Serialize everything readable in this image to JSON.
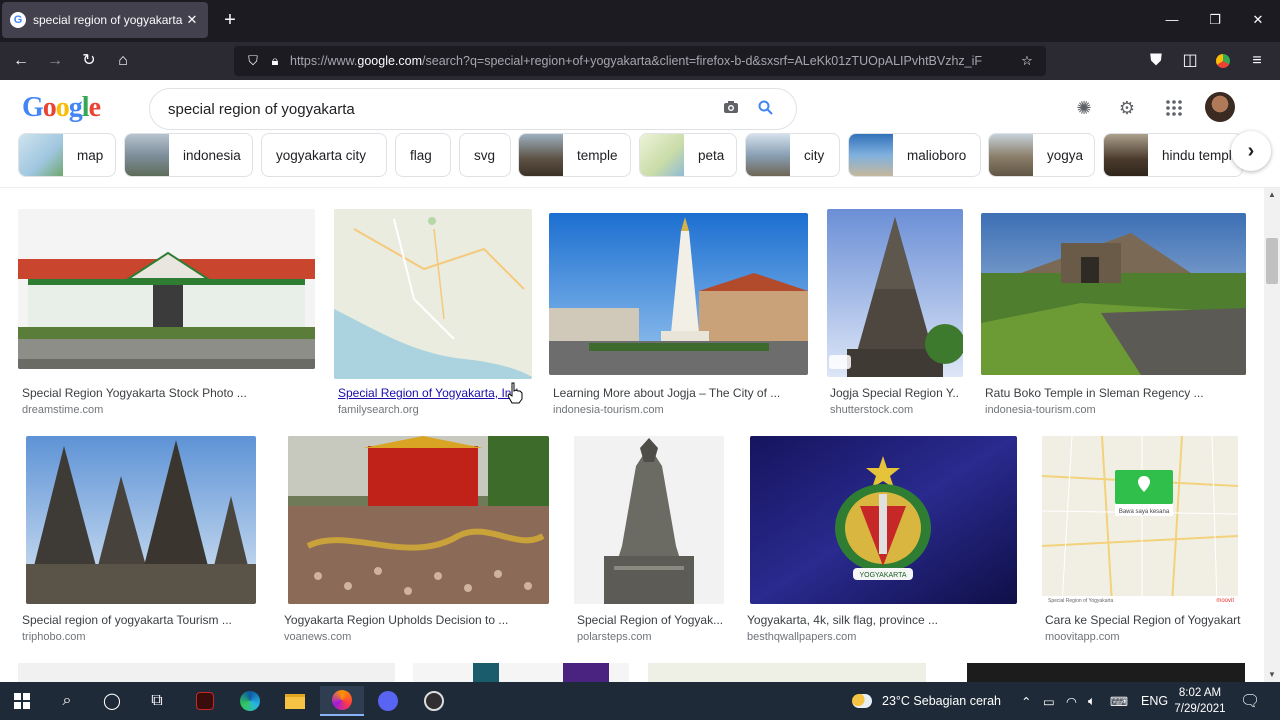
{
  "browser": {
    "tab_title": "special region of yogyakarta - G",
    "url_pre": "https://www.",
    "url_domain": "google.com",
    "url_post": "/search?q=special+region+of+yogyakarta&client=firefox-b-d&sxsrf=ALeKk01zTUOpALIPvhtBVzhz_iF"
  },
  "google": {
    "logo": [
      "G",
      "o",
      "o",
      "g",
      "l",
      "e"
    ],
    "logo_colors": [
      "#4285f4",
      "#ea4335",
      "#fbbc05",
      "#4285f4",
      "#34a853",
      "#ea4335"
    ],
    "query": "special region of yogyakarta",
    "chips": [
      {
        "label": "map",
        "thumb": "#9fc6df"
      },
      {
        "label": "indonesia",
        "thumb": "#7f8f9c"
      },
      {
        "label": "yogyakarta city",
        "thumb": null
      },
      {
        "label": "flag",
        "thumb": null
      },
      {
        "label": "svg",
        "thumb": null
      },
      {
        "label": "temple",
        "thumb": "#5b5042"
      },
      {
        "label": "peta",
        "thumb": "#c9dca8"
      },
      {
        "label": "city",
        "thumb": "#8aa0b4"
      },
      {
        "label": "malioboro",
        "thumb": "#2f6fb8"
      },
      {
        "label": "yogya",
        "thumb": "#8a7d68"
      },
      {
        "label": "hindu templ",
        "thumb": "#4a3a2c"
      }
    ]
  },
  "results": [
    {
      "caption": "Special Region Yogyakarta Stock Photo ...",
      "source": "dreamstime.com"
    },
    {
      "caption": "Special Region of Yogyakarta, Ind",
      "source": "familysearch.org"
    },
    {
      "caption": "Learning More about Jogja – The City of ...",
      "source": "indonesia-tourism.com"
    },
    {
      "caption": "Jogja Special Region Y...",
      "source": "shutterstock.com"
    },
    {
      "caption": "Ratu Boko Temple in Sleman Regency ...",
      "source": "indonesia-tourism.com"
    },
    {
      "caption": "Special region of yogyakarta Tourism ...",
      "source": "triphobo.com"
    },
    {
      "caption": "Yogyakarta Region Upholds Decision to ...",
      "source": "voanews.com"
    },
    {
      "caption": "Special Region of Yogyak...",
      "source": "polarsteps.com"
    },
    {
      "caption": "Yogyakarta, 4k, silk flag, province ...",
      "source": "besthqwallpapers.com"
    },
    {
      "caption": "Cara ke Special Region of Yogyakart...",
      "source": "moovitapp.com"
    }
  ],
  "map_card": {
    "pin_label": "Bawa saya kesana",
    "footer": "Special Region of Yogyakarta",
    "brand": "moovit"
  },
  "flag_badge": "YOGYAKARTA",
  "taskbar": {
    "weather": "23°C  Sebagian cerah",
    "lang": "ENG",
    "time": "8:02 AM",
    "date": "7/29/2021"
  }
}
